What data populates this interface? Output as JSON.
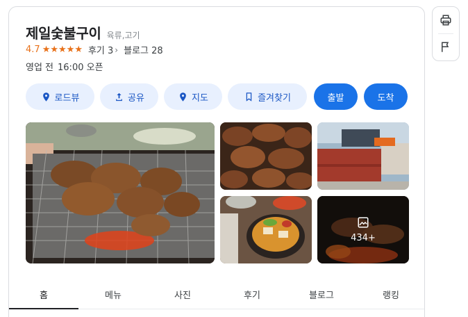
{
  "place": {
    "name": "제일숯불구이",
    "category": "육류,고기",
    "rating": "4.7",
    "stars": 5,
    "reviews_label": "후기 3",
    "blogs_label": "블로그 28",
    "hours_status": "영업 전",
    "hours_detail": "16:00 오픈"
  },
  "actions": {
    "roadview": "로드뷰",
    "share": "공유",
    "map": "지도",
    "bookmark": "즐겨찾기",
    "depart": "출발",
    "arrive": "도착"
  },
  "photos": {
    "more_count": "434+"
  },
  "tabs": [
    "홈",
    "메뉴",
    "사진",
    "후기",
    "블로그",
    "랭킹"
  ],
  "colors": {
    "accent": "#1a73e8",
    "chip_bg": "#e8f0fe",
    "rating": "#e8711a"
  },
  "icons": {
    "print": "print-icon",
    "report": "flag-icon",
    "roadview": "location-pin-icon",
    "share": "share-icon",
    "map": "map-pin-icon",
    "bookmark": "bookmark-icon",
    "gallery": "image-icon"
  }
}
